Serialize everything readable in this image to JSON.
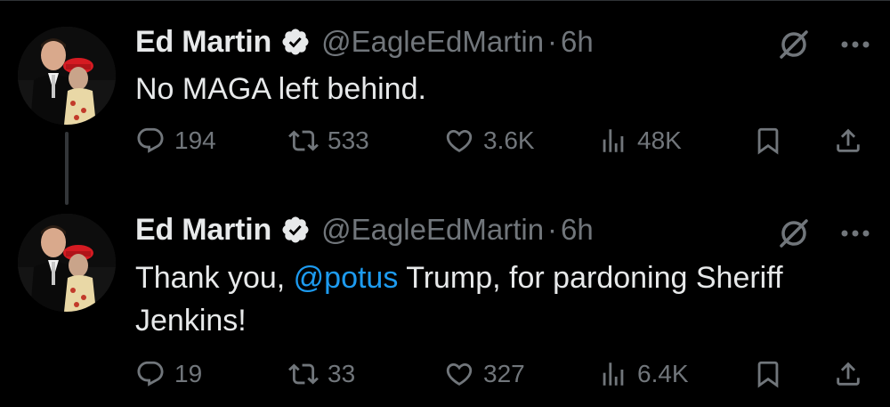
{
  "tweets": [
    {
      "author_name": "Ed Martin",
      "handle": "@EagleEdMartin",
      "separator": "·",
      "time": "6h",
      "text": "No MAGA left behind.",
      "mention": "",
      "text_after": "",
      "replies": "194",
      "retweets": "533",
      "likes": "3.6K",
      "views": "48K"
    },
    {
      "author_name": "Ed Martin",
      "handle": "@EagleEdMartin",
      "separator": "·",
      "time": "6h",
      "text": "Thank you, ",
      "mention": "@potus",
      "text_after": " Trump, for pardoning Sheriff Jenkins!",
      "replies": "19",
      "retweets": "33",
      "likes": "327",
      "views": "6.4K"
    }
  ],
  "icons": {
    "verified": "verified-badge-icon",
    "grok": "grok-slash-icon",
    "more": "more-dots-icon",
    "reply": "reply-icon",
    "retweet": "retweet-icon",
    "like": "heart-icon",
    "views": "views-chart-icon",
    "bookmark": "bookmark-icon",
    "share": "share-icon"
  },
  "colors": {
    "background": "#000000",
    "text": "#e7e9ea",
    "muted": "#71767b",
    "link": "#1d9bf0",
    "thread_line": "#333639"
  }
}
